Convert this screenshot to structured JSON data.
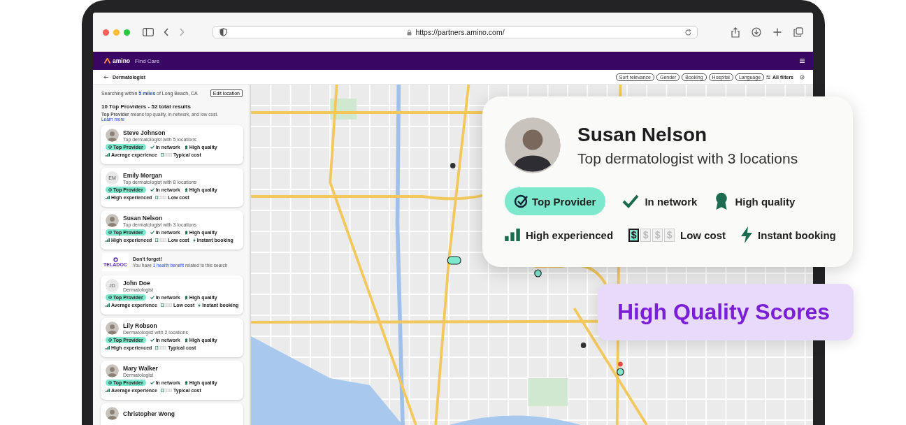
{
  "browser": {
    "url": "https://partners.amino.com/"
  },
  "app_bar": {
    "logo": "amino",
    "product": "Find Care"
  },
  "subheader": {
    "title": "Dermatologist",
    "filters": [
      "Sort relevance",
      "Gender",
      "Booking",
      "Hospital",
      "Language"
    ],
    "all_filters": "All filters"
  },
  "sidebar": {
    "search_prefix": "Searching within",
    "distance": "5 miles",
    "search_suffix": "of Long Beach, CA",
    "edit_location": "Edit location",
    "results_title": "10 Top Providers - 52 total results",
    "note": "**Top Provider** means top quality, in-network, and low cost.",
    "learn_more": "Learn more",
    "items": [
      {
        "kind": "provider",
        "name": "Steve Johnson",
        "subtitle": "Top dermatologist with 5 locations",
        "tags": [
          {
            "kind": "top",
            "label": "Top Provider"
          },
          {
            "kind": "network",
            "label": "In network"
          },
          {
            "kind": "quality",
            "label": "High quality"
          }
        ],
        "stats": [
          {
            "kind": "experience",
            "label": "Average experience"
          },
          {
            "kind": "cost",
            "label": "Typical cost"
          }
        ]
      },
      {
        "kind": "provider",
        "name": "Emily Morgan",
        "subtitle": "Top dermatologist with 8 locations",
        "initials": "EM",
        "tags": [
          {
            "kind": "top",
            "label": "Top Provider"
          },
          {
            "kind": "network",
            "label": "In network"
          },
          {
            "kind": "quality",
            "label": "High quality"
          }
        ],
        "stats": [
          {
            "kind": "experience",
            "label": "High experienced"
          },
          {
            "kind": "cost",
            "label": "Low cost"
          }
        ]
      },
      {
        "kind": "provider",
        "name": "Susan Nelson",
        "subtitle": "Top dermatologist with 3 locations",
        "tags": [
          {
            "kind": "top",
            "label": "Top Provider"
          },
          {
            "kind": "network",
            "label": "In network"
          },
          {
            "kind": "quality",
            "label": "High quality"
          }
        ],
        "stats": [
          {
            "kind": "experience",
            "label": "High experienced"
          },
          {
            "kind": "cost",
            "label": "Low cost"
          },
          {
            "kind": "booking",
            "label": "Instant booking"
          }
        ]
      },
      {
        "kind": "promo",
        "logo_text": "TELADOC",
        "title": "Don't forget!",
        "text_before": "You have",
        "link": "1 health benefit",
        "text_after": "related to this search"
      },
      {
        "kind": "provider",
        "name": "John Doe",
        "subtitle": "Dermatologist",
        "initials": "JD",
        "tags": [
          {
            "kind": "top",
            "label": "Top Provider"
          },
          {
            "kind": "network",
            "label": "In network"
          },
          {
            "kind": "quality",
            "label": "High quality"
          }
        ],
        "stats": [
          {
            "kind": "experience",
            "label": "Average experience"
          },
          {
            "kind": "cost",
            "label": "Low cost"
          },
          {
            "kind": "booking",
            "label": "Instant booking"
          }
        ]
      },
      {
        "kind": "provider",
        "name": "Lily Robson",
        "subtitle": "Dermatologist with 2 locations",
        "tags": [
          {
            "kind": "top",
            "label": "Top Provider"
          },
          {
            "kind": "network",
            "label": "In network"
          },
          {
            "kind": "quality",
            "label": "High quality"
          }
        ],
        "stats": [
          {
            "kind": "experience",
            "label": "High experienced"
          },
          {
            "kind": "cost",
            "label": "Typical cost"
          }
        ]
      },
      {
        "kind": "provider",
        "name": "Mary Walker",
        "subtitle": "Dermatologist",
        "tags": [
          {
            "kind": "top",
            "label": "Top Provider"
          },
          {
            "kind": "network",
            "label": "In network"
          },
          {
            "kind": "quality",
            "label": "High quality"
          }
        ],
        "stats": [
          {
            "kind": "experience",
            "label": "Average experience"
          },
          {
            "kind": "cost",
            "label": "Typical cost"
          }
        ]
      },
      {
        "kind": "provider",
        "name": "Christopher Wong"
      }
    ]
  },
  "featured": {
    "name": "Susan Nelson",
    "subtitle": "Top dermatologist with 3 locations",
    "tags": [
      {
        "kind": "top",
        "label": "Top Provider"
      },
      {
        "kind": "network",
        "label": "In network"
      },
      {
        "kind": "quality",
        "label": "High quality"
      }
    ],
    "stats": [
      {
        "kind": "experience",
        "label": "High experienced"
      },
      {
        "kind": "cost",
        "label": "Low cost",
        "symbols": [
          {
            "symbol": "$",
            "filled": true
          },
          {
            "symbol": "$",
            "filled": false
          },
          {
            "symbol": "$",
            "filled": false
          },
          {
            "symbol": "$",
            "filled": false
          }
        ]
      },
      {
        "kind": "booking",
        "label": "Instant booking"
      }
    ]
  },
  "banner": {
    "text": "High Quality Scores"
  }
}
